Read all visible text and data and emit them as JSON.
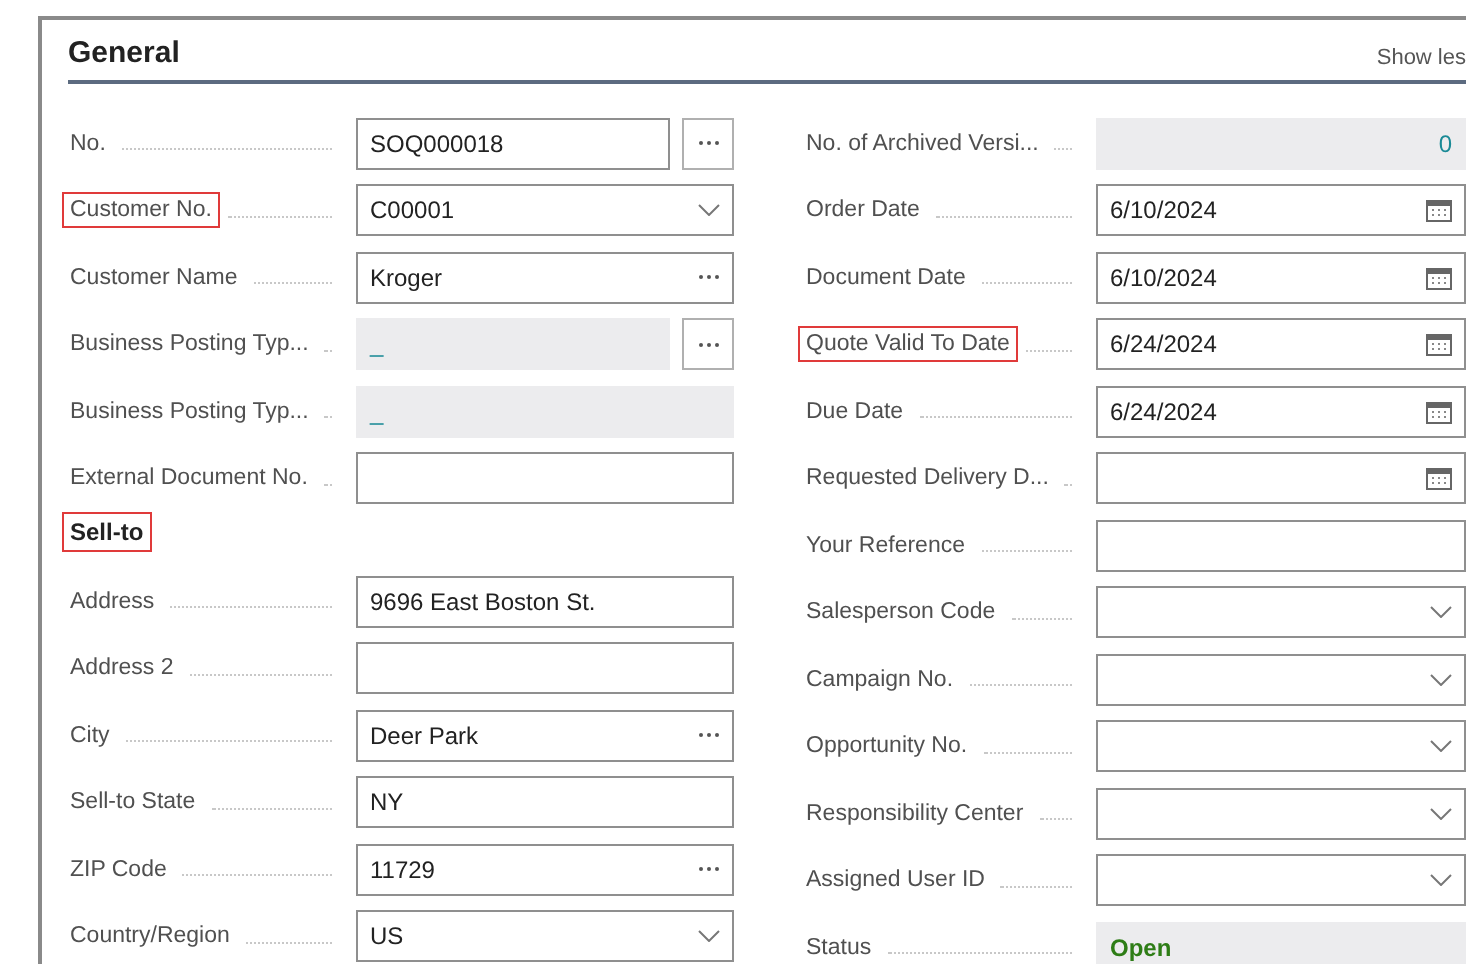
{
  "section": {
    "title": "General",
    "toggle": "Show les"
  },
  "left": [
    {
      "kind": "text",
      "label": "No.",
      "value": "SOQ000018",
      "assist": true,
      "highlighted": false
    },
    {
      "kind": "select",
      "label": "Customer No.",
      "value": "C00001",
      "highlighted": true
    },
    {
      "kind": "lookup",
      "label": "Customer Name",
      "value": "Kroger",
      "highlighted": false
    },
    {
      "kind": "readonly-link",
      "label": "Business Posting Typ...",
      "value": "_",
      "assist": true,
      "highlighted": false
    },
    {
      "kind": "readonly-link",
      "label": "Business Posting Typ...",
      "value": "_",
      "highlighted": false
    },
    {
      "kind": "text",
      "label": "External Document No.",
      "highlighted": false
    },
    {
      "kind": "group",
      "label": "Sell-to",
      "highlighted": true
    },
    {
      "kind": "text",
      "label": "Address",
      "value": "9696 East Boston St.",
      "highlighted": false
    },
    {
      "kind": "text",
      "label": "Address 2",
      "highlighted": false
    },
    {
      "kind": "lookup",
      "label": "City",
      "value": "Deer Park",
      "highlighted": false
    },
    {
      "kind": "text",
      "label": "Sell-to State",
      "value": "NY",
      "highlighted": false
    },
    {
      "kind": "lookup",
      "label": "ZIP Code",
      "value": "11729",
      "highlighted": false
    },
    {
      "kind": "select",
      "label": "Country/Region",
      "value": "US",
      "highlighted": false
    }
  ],
  "right": [
    {
      "kind": "readonly-number",
      "label": "No. of Archived Versi...",
      "value": "0",
      "highlighted": false
    },
    {
      "kind": "date",
      "label": "Order Date",
      "value": "6/10/2024",
      "highlighted": false
    },
    {
      "kind": "date",
      "label": "Document Date",
      "value": "6/10/2024",
      "highlighted": false
    },
    {
      "kind": "date",
      "label": "Quote Valid To Date",
      "value": "6/24/2024",
      "highlighted": true
    },
    {
      "kind": "date",
      "label": "Due Date",
      "value": "6/24/2024",
      "highlighted": false
    },
    {
      "kind": "date",
      "label": "Requested Delivery D...",
      "highlighted": false
    },
    {
      "kind": "text",
      "label": "Your Reference",
      "highlighted": false
    },
    {
      "kind": "select",
      "label": "Salesperson Code",
      "highlighted": false
    },
    {
      "kind": "select",
      "label": "Campaign No.",
      "highlighted": false
    },
    {
      "kind": "select",
      "label": "Opportunity No.",
      "highlighted": false
    },
    {
      "kind": "select",
      "label": "Responsibility Center",
      "highlighted": false
    },
    {
      "kind": "select",
      "label": "Assigned User ID",
      "highlighted": false
    },
    {
      "kind": "status",
      "label": "Status",
      "value": "Open",
      "highlighted": false
    }
  ]
}
